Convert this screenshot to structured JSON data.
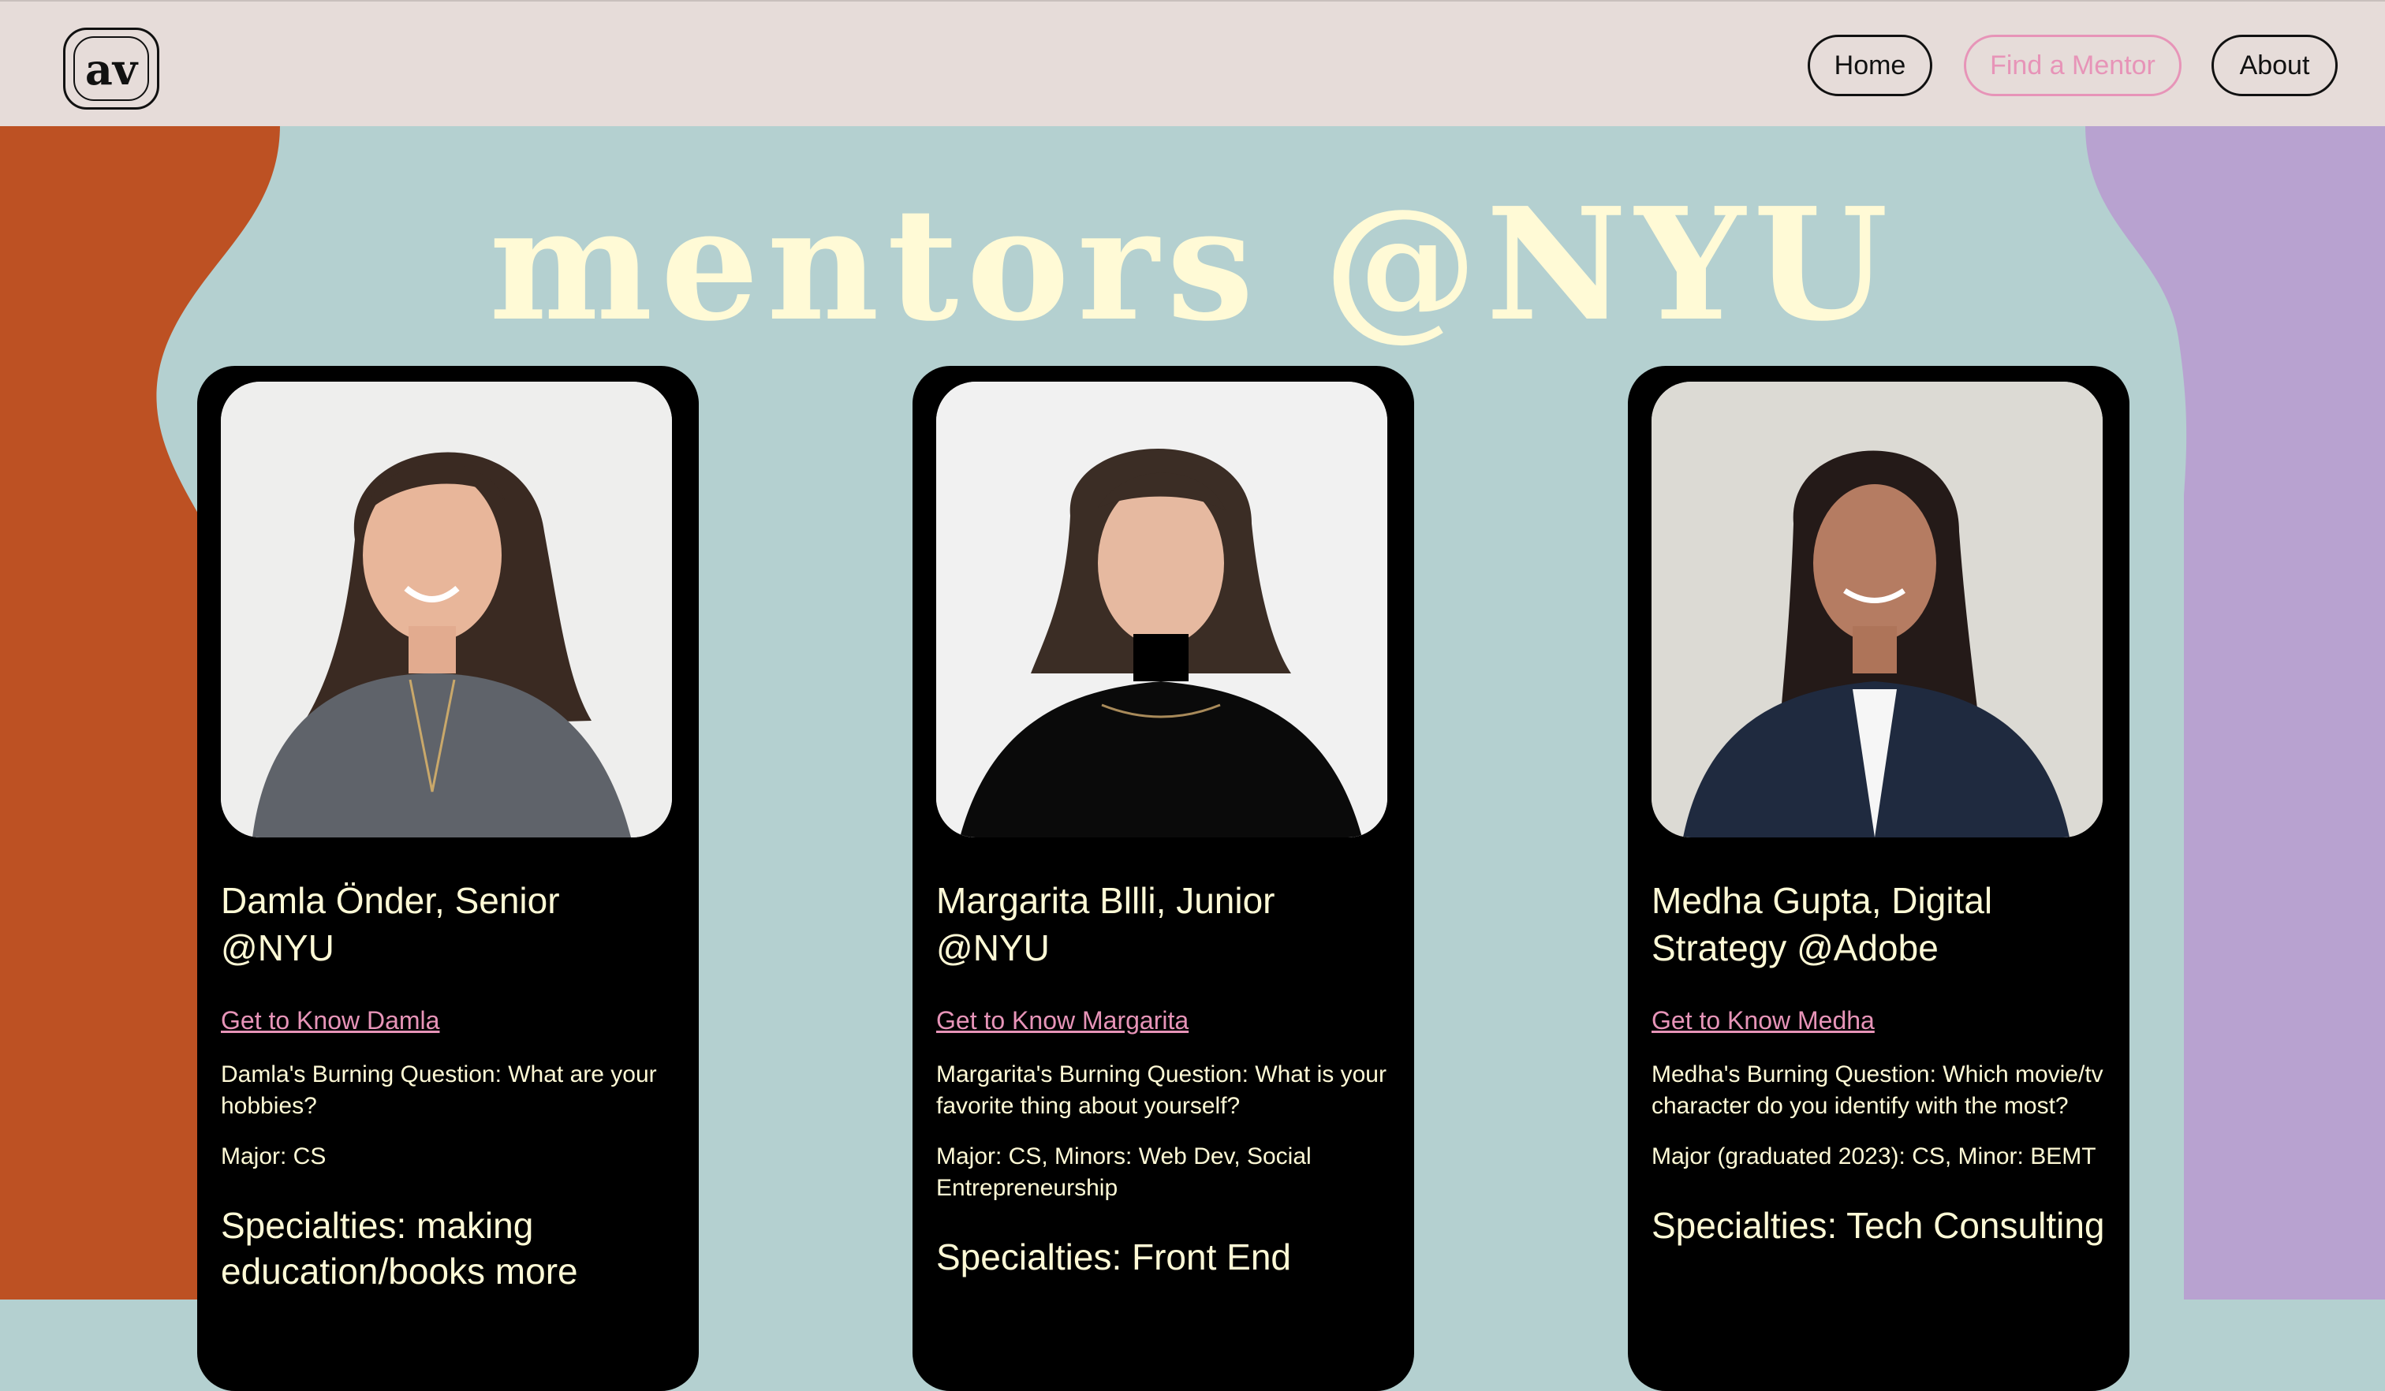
{
  "header": {
    "logo_text": "av",
    "nav": {
      "home": "Home",
      "find_mentor": "Find a Mentor",
      "about": "About"
    }
  },
  "colors": {
    "header_bg": "#e6dcd9",
    "page_bg": "#b4d0d0",
    "left_blob": "#bd5123",
    "right_blob": "#b8a2d0",
    "title": "#fffad6",
    "card_bg": "#000000",
    "link": "#e794b8",
    "card_text": "#fffad6"
  },
  "main": {
    "title": "mentors @NYU",
    "mentors": [
      {
        "name": "Damla Önder, Senior @NYU",
        "link": "Get to Know Damla",
        "question": "Damla's Burning Question: What are your hobbies?",
        "major": "Major: CS",
        "specialties": "Specialties: making education/books more"
      },
      {
        "name": "Margarita Bllli, Junior @NYU",
        "link": "Get to Know Margarita",
        "question": "Margarita's Burning Question: What is your favorite thing about yourself?",
        "major": "Major: CS, Minors: Web Dev, Social Entrepreneurship",
        "specialties": "Specialties: Front End"
      },
      {
        "name": "Medha Gupta, Digital Strategy @Adobe",
        "link": "Get to Know Medha",
        "question": "Medha's Burning Question: Which movie/tv character do you identify with the most?",
        "major": "Major (graduated 2023): CS, Minor: BEMT",
        "specialties": "Specialties: Tech Consulting"
      }
    ]
  }
}
